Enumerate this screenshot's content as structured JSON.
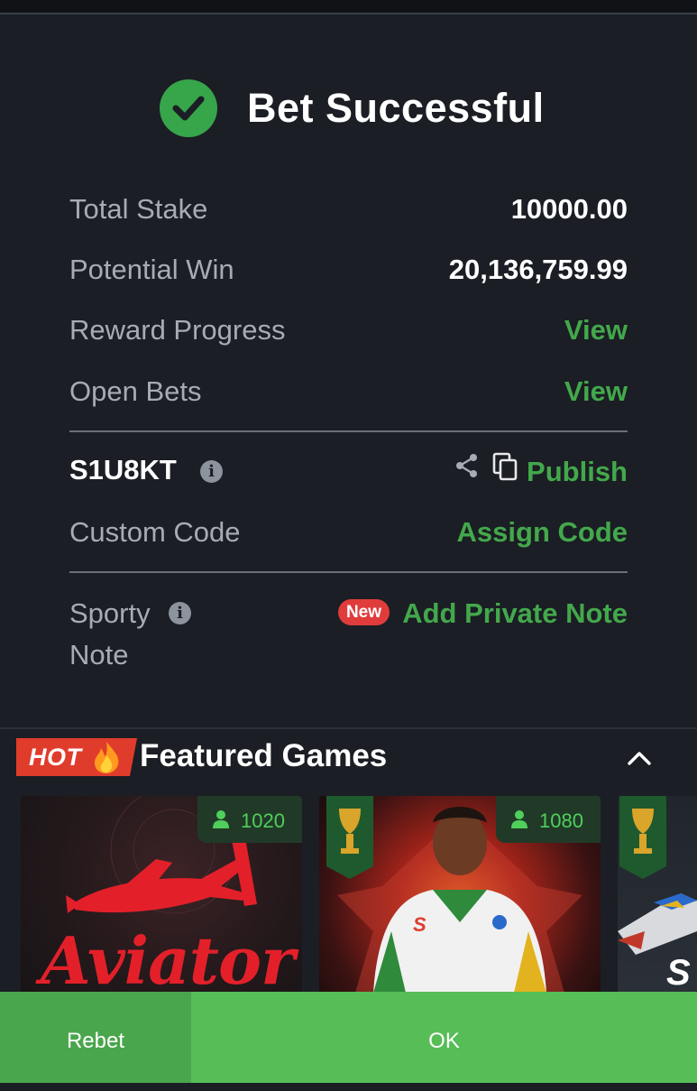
{
  "header": {
    "title": "Bet Successful"
  },
  "summary": {
    "total_stake_label": "Total Stake",
    "total_stake_value": "10000.00",
    "potential_win_label": "Potential Win",
    "potential_win_value": "20,136,759.99",
    "reward_progress_label": "Reward Progress",
    "reward_progress_link": "View",
    "open_bets_label": "Open Bets",
    "open_bets_link": "View"
  },
  "booking": {
    "code": "S1U8KT",
    "publish_label": "Publish",
    "custom_code_label": "Custom Code",
    "assign_code_label": "Assign Code"
  },
  "note": {
    "label_line1": "Sporty",
    "label_line2": "Note",
    "new_badge": "New",
    "add_note_label": "Add Private Note"
  },
  "featured": {
    "hot_label": "HOT",
    "title": "Featured Games",
    "games": [
      {
        "name": "Aviator",
        "players": "1020",
        "logo_text": "Aviator"
      },
      {
        "name": "football-hero-game",
        "players": "1080"
      },
      {
        "name": "partial-game",
        "logo_text": "S"
      }
    ]
  },
  "footer": {
    "rebet_label": "Rebet",
    "ok_label": "OK"
  },
  "colors": {
    "background": "#1b1e24",
    "accent_green": "#43a84c",
    "label_grey": "#a7acb4",
    "new_red": "#e03c3c",
    "hot_red": "#e03c2c"
  },
  "icons": [
    "check-icon",
    "info-icon",
    "share-icon",
    "copy-icon",
    "flame-icon",
    "chevron-up-icon",
    "person-icon",
    "trophy-banner-icon"
  ]
}
